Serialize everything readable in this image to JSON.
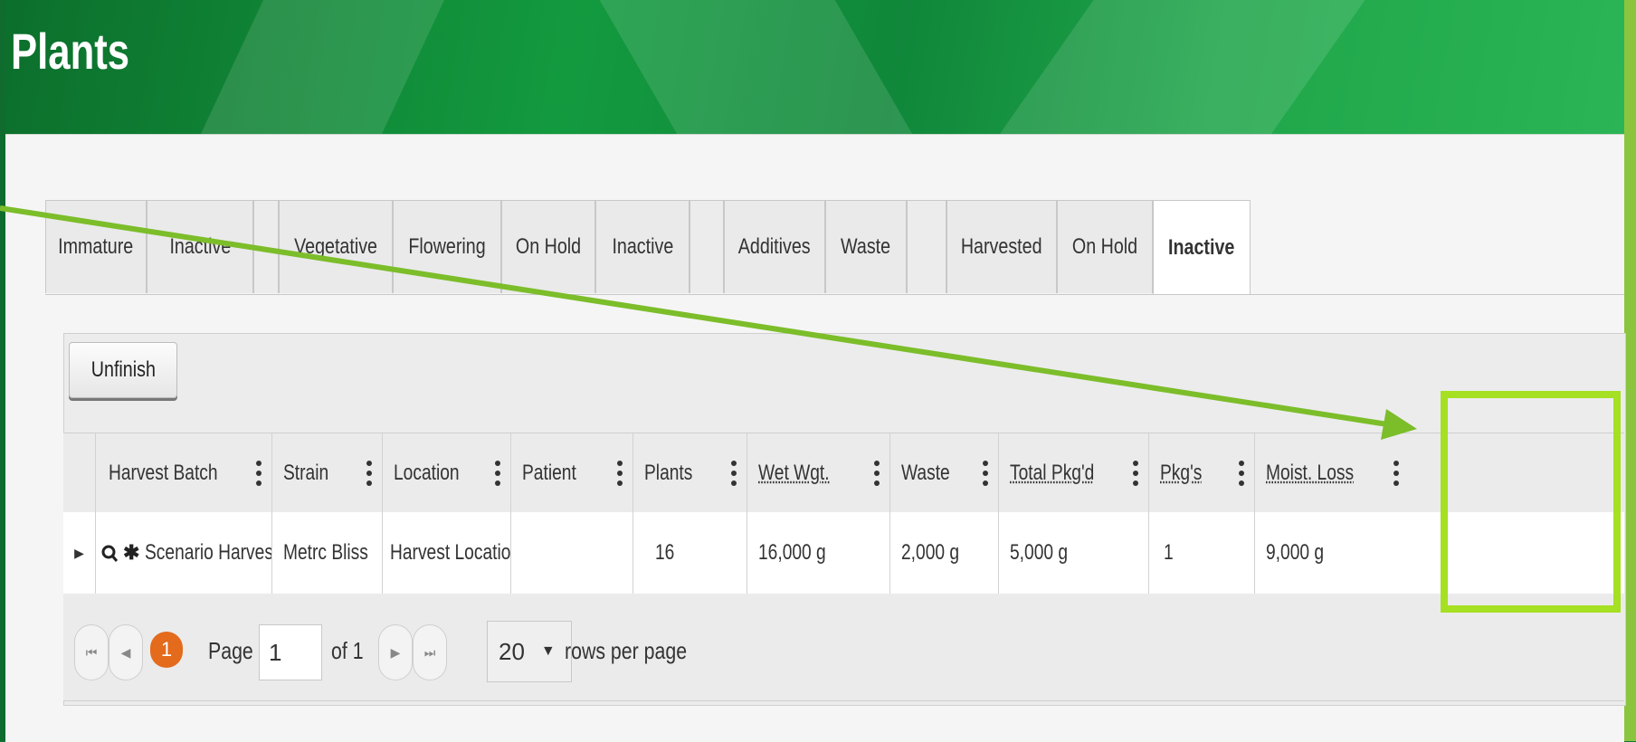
{
  "page": {
    "title": "Plants"
  },
  "tabs": [
    {
      "label": "Immature"
    },
    {
      "label": "Inactive"
    },
    {
      "label": ""
    },
    {
      "label": "Vegetative"
    },
    {
      "label": "Flowering"
    },
    {
      "label": "On Hold"
    },
    {
      "label": "Inactive"
    },
    {
      "label": ""
    },
    {
      "label": "Additives"
    },
    {
      "label": "Waste"
    },
    {
      "label": ""
    },
    {
      "label": "Harvested"
    },
    {
      "label": "On Hold"
    },
    {
      "label": "Inactive"
    }
  ],
  "active_tab": "Inactive",
  "toolbar": {
    "unfinish_label": "Unfinish"
  },
  "grid": {
    "columns": [
      {
        "label": "Harvest Batch",
        "sortable_underline": false
      },
      {
        "label": "Strain",
        "sortable_underline": false
      },
      {
        "label": "Location",
        "sortable_underline": false
      },
      {
        "label": "Patient",
        "sortable_underline": false
      },
      {
        "label": "Plants",
        "sortable_underline": false
      },
      {
        "label": "Wet Wgt.",
        "sortable_underline": true
      },
      {
        "label": "Waste",
        "sortable_underline": false
      },
      {
        "label": "Total Pkg'd",
        "sortable_underline": true
      },
      {
        "label": "Pkg's",
        "sortable_underline": true
      },
      {
        "label": "Moist. Loss",
        "sortable_underline": true
      }
    ],
    "rows": [
      {
        "harvest_batch": "Scenario Harvest",
        "strain": "Metrc Bliss",
        "location": "Harvest Location",
        "patient": "",
        "plants": "16",
        "wet_wgt": "16,000 g",
        "waste": "2,000 g",
        "total_pkgd": "5,000 g",
        "pkgs": "1",
        "moist_loss": "9,000 g"
      }
    ]
  },
  "pager": {
    "current_page_badge": "1",
    "page_label": "Page",
    "page_value": "1",
    "of_label": "of 1",
    "rows_per_page_value": "20",
    "rows_per_page_label": "rows per page"
  },
  "icons": {
    "expand": "caret-right-icon",
    "view": "search-icon",
    "settings": "asterisk-icon"
  },
  "colors": {
    "banner_green": "#139a3f",
    "frame_green": "#8bc53f",
    "highlight": "#a6e022",
    "arrow": "#7cbd2a",
    "page_badge": "#e46a1c"
  }
}
